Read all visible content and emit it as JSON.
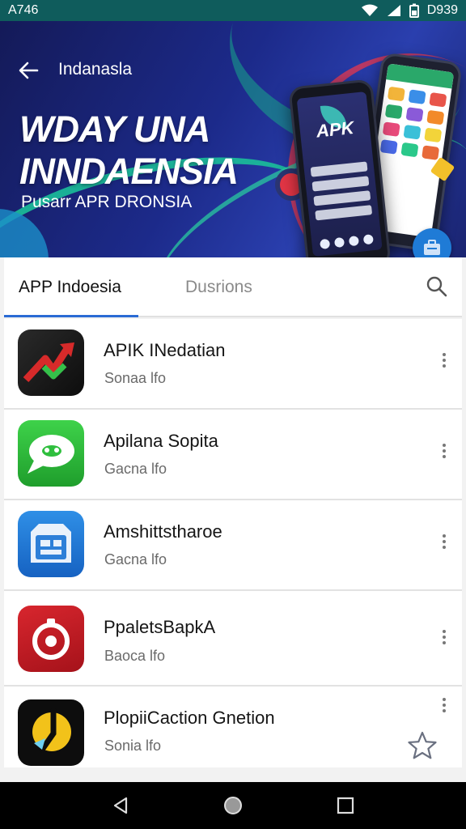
{
  "status_bar": {
    "left_text": "A746",
    "time": "D939"
  },
  "header": {
    "title": "Indanasla",
    "headline_line1": "WDAY UNA",
    "headline_line2": "INNDAENSIA",
    "subtitle": "Pusarr APR DRONSIA",
    "phone_logo": "APK"
  },
  "tabs": [
    {
      "label": "APP Indoesia",
      "active": true
    },
    {
      "label": "Dusrions",
      "active": false
    }
  ],
  "apps": [
    {
      "name": "APIK INedatian",
      "sub": "Sonaa lfo",
      "icon": "chart-arrow-icon"
    },
    {
      "name": "Apilana Sopita",
      "sub": "Gacna lfo",
      "icon": "chat-bubble-icon"
    },
    {
      "name": "Amshittstharoe",
      "sub": "Gacna lfo",
      "icon": "briefcase-icon"
    },
    {
      "name": "PpaletsBapkA",
      "sub": "Baoca lfo",
      "icon": "target-icon"
    },
    {
      "name": "PlopiiCaction Gnetion",
      "sub": "Sonia lfo",
      "icon": "pointer-icon"
    }
  ],
  "colors": {
    "status_bar": "#0f5c5c",
    "hero_bg": "#1c2a8a",
    "accent": "#2a6bd4",
    "nav_bar": "#000000"
  }
}
